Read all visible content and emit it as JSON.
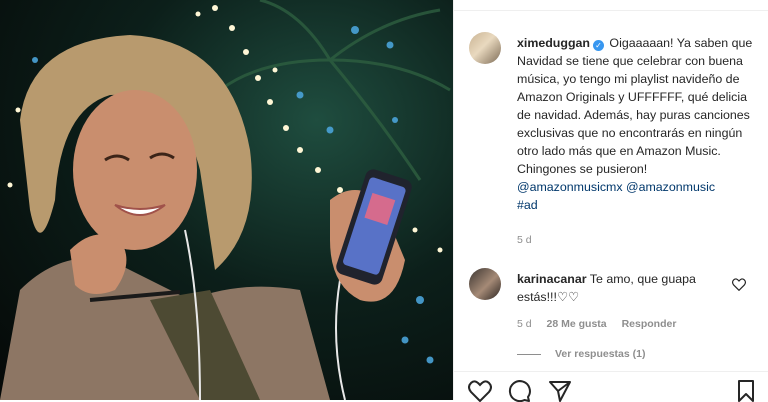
{
  "post": {
    "username": "ximeduggan",
    "verified_glyph": "✓",
    "caption_text": " Oigaaaaan! Ya saben que Navidad se tiene que celebrar con buena música, yo tengo mi playlist navideño de Amazon Originals y UFFFFFF, qué delicia de navidad. Además, hay puras canciones exclusivas que no encontrarás en ningún otro lado más que en Amazon Music. Chingones se pusieron! ",
    "mentions": [
      "@amazonmusicmx",
      "@amazonmusic"
    ],
    "hashtag": "#ad",
    "time": "5 d"
  },
  "comment": {
    "username": "karinacanar",
    "text": " Te amo, que guapa estás!!!♡♡",
    "time": "5 d",
    "likes": "28 Me gusta",
    "reply_label": "Responder",
    "view_replies": "Ver respuestas (1)"
  },
  "icons": [
    "heart-icon",
    "comment-icon",
    "share-icon",
    "bookmark-icon",
    "verified-icon"
  ],
  "colors": {
    "link": "#00376b",
    "muted": "#8e8e8e",
    "verified": "#3897f0"
  }
}
